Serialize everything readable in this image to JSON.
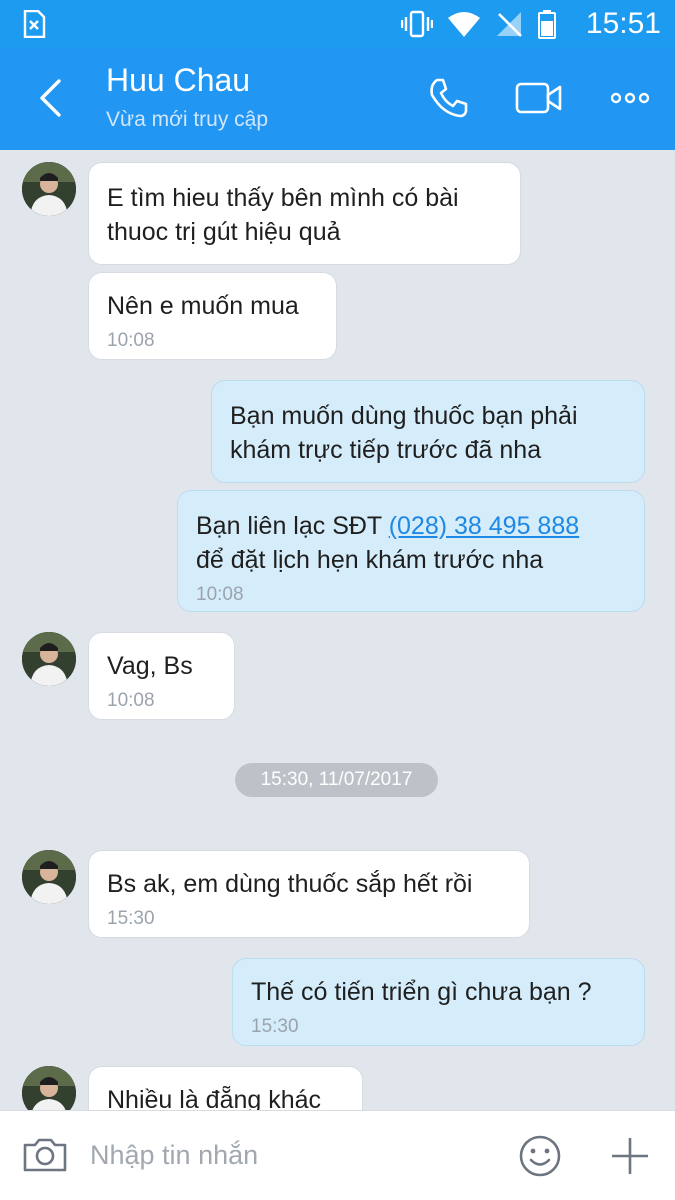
{
  "status_bar": {
    "time": "15:51",
    "icons": [
      "sim-error-icon",
      "vibrate-icon",
      "wifi-icon",
      "no-signal-icon",
      "battery-icon"
    ]
  },
  "header": {
    "contact_name": "Huu Chau",
    "contact_status": "Vừa mới truy cập",
    "icons": [
      "back-arrow-icon",
      "phone-icon",
      "video-camera-icon",
      "more-dots-icon"
    ]
  },
  "messages": [
    {
      "side": "in",
      "lines": [
        "E tìm hieu thấy bên mình có bài",
        "thuoc trị gút hiệu quả"
      ]
    },
    {
      "side": "in",
      "lines": [
        "Nên e muốn mua"
      ],
      "time": "10:08"
    },
    {
      "side": "out",
      "lines": [
        "Bạn muốn dùng thuốc bạn phải",
        "khám trực tiếp trước đã nha"
      ]
    },
    {
      "side": "out",
      "lines": [
        "Bạn liên lạc SĐT ",
        "để đặt lịch hẹn khám trước nha"
      ],
      "link": "(028) 38 495 888",
      "time": "10:08"
    },
    {
      "side": "in",
      "lines": [
        "Vag, Bs"
      ],
      "time": "10:08"
    },
    {
      "side": "in",
      "lines": [
        "Bs ak, em dùng thuốc sắp hết rồi"
      ],
      "time": "15:30"
    },
    {
      "side": "out",
      "lines": [
        "Thế có tiến triển gì chưa bạn ?"
      ],
      "time": "15:30"
    },
    {
      "side": "in",
      "lines": [
        "Nhiều là đẵng khác"
      ]
    }
  ],
  "date_separator": "15:30, 11/07/2017",
  "input_bar": {
    "placeholder": "Nhập tin nhắn",
    "icons": [
      "camera-icon",
      "emoji-icon",
      "plus-icon"
    ]
  },
  "colors": {
    "header": "#2196f3",
    "chat_background": "#e1e5ec",
    "outgoing_bubble": "#d5ecfa",
    "incoming_bubble": "#ffffff",
    "link": "#1e88e5"
  }
}
